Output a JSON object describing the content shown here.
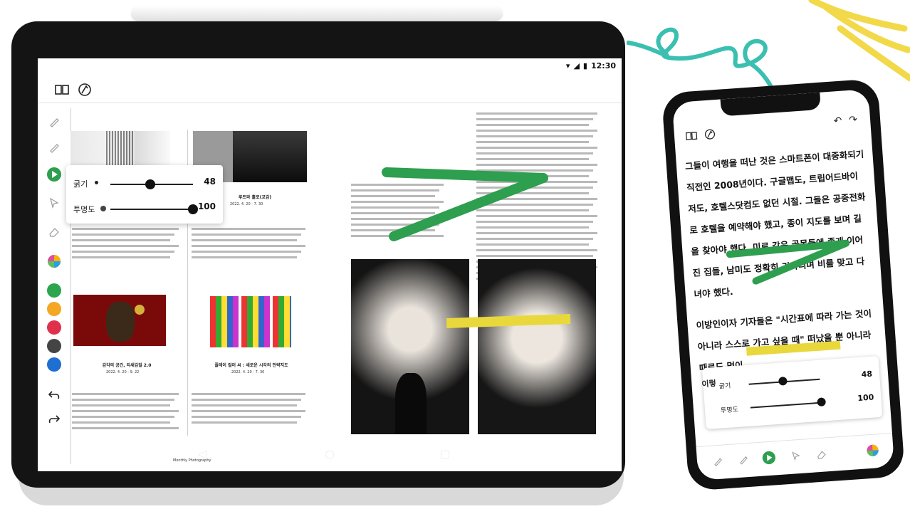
{
  "tablet": {
    "status_time": "12:30",
    "popup": {
      "thickness_label": "굵기",
      "thickness_value": "48",
      "thickness_level": 0.48,
      "opacity_label": "투명도",
      "opacity_value": "100",
      "opacity_level": 1.0
    },
    "colors": [
      "#2da44e",
      "#f5a623",
      "#e0314b",
      "#444444",
      "#1f6fd0"
    ],
    "highlight_green": "#2e9e4f",
    "highlight_yellow": "#e9d83c",
    "captions": {
      "exhibit_1": "루트와 홀로(교감)",
      "exhibit_1_sub": "2022. 4. 20 - 7. 30",
      "exhibit_2": "감각의 공간, 되새김질 2.0",
      "exhibit_2_sub": "2022. 4. 20 - 9. 22",
      "exhibit_3": "플레이 컬러 씨 : 새로운 시각의 전략지도",
      "exhibit_3_sub": "2022. 4. 20 - 7. 30",
      "footer": "Monthly Photography"
    }
  },
  "phone": {
    "paragraph_1": "그들이 여행을 떠난 것은 스마트폰이 대중화되기 직전인 2008년이다. 구글맵도, 트립어드바이저도, 호텔스닷컴도 없던 시절. 그들은 공중전화로 호텔을 예약해야 했고, 종이 지도를 보며 길을 찾아야 했다. 미로 같은 골목들에 좁게 이어진 집들, 남미도 정확히 기다리며 비를 맞고 다녀야 했다.",
    "paragraph_2": "이방인이자 기자들은 \"시간표에 따라 가는 것이 아니라 스스로 가고 싶을 때\" 떠났을 뿐 아니라 때로도 멈이",
    "popup": {
      "thickness_label": "굵기",
      "thickness_value": "48",
      "thickness_level": 0.48,
      "opacity_label": "투명도",
      "opacity_value": "100",
      "opacity_level": 1.0
    },
    "popup_prefix": "이렇"
  },
  "decor": {
    "teal": "#3bbfb0",
    "yellow": "#f2d94a"
  }
}
